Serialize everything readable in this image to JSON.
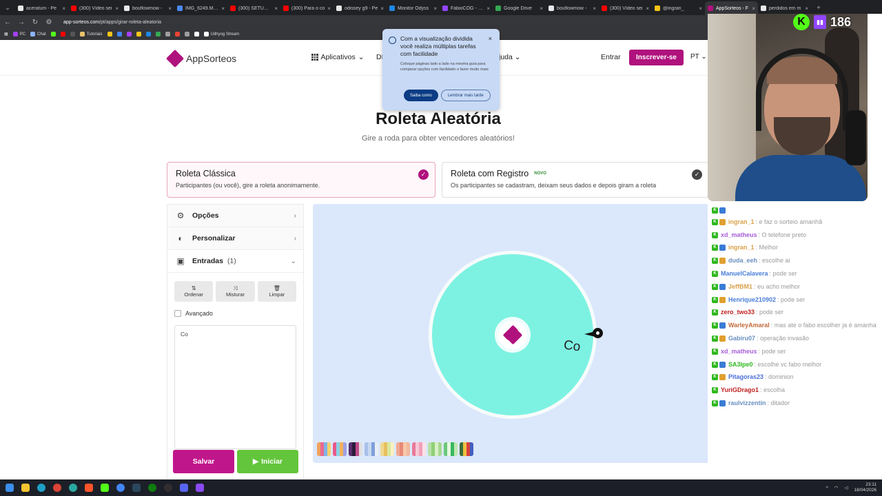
{
  "browser": {
    "tabs": [
      {
        "title": "aceratum - Pe",
        "color": "#e8e8e8",
        "active": false
      },
      {
        "title": "(300) Vídeo sei",
        "color": "#ff0000",
        "active": false
      },
      {
        "title": "bouflowmow -",
        "color": "#e8e8e8",
        "active": false
      },
      {
        "title": "IMG_6249.MOV",
        "color": "#4a8af4",
        "active": false
      },
      {
        "title": "(300) SETUP D",
        "color": "#ff0000",
        "active": false
      },
      {
        "title": "(300) Para o co",
        "color": "#ff0000",
        "active": false
      },
      {
        "title": "odissey g9 - Pe",
        "color": "#e8e8e8",
        "active": false
      },
      {
        "title": "Monitor Odyss",
        "color": "#1e88e5",
        "active": false
      },
      {
        "title": "FabioCOG - Ch",
        "color": "#9146ff",
        "active": false
      },
      {
        "title": "Google Drive",
        "color": "#34a853",
        "active": false
      },
      {
        "title": "bouflowmow -",
        "color": "#e8e8e8",
        "active": false
      },
      {
        "title": "(300) Vídeo sei",
        "color": "#ff0000",
        "active": false
      },
      {
        "title": "@ingran_",
        "color": "#f5c518",
        "active": false
      },
      {
        "title": "AppSorteos - F",
        "color": "#b0127d",
        "active": true
      },
      {
        "title": "perdidos em m",
        "color": "#e8e8e8",
        "active": false
      }
    ],
    "url_host": "app-sorteos.com",
    "url_path": "/pt/apps/girar-roleta-aleatoria",
    "bookmarks": [
      {
        "label": "PC",
        "color": "#a142f4"
      },
      {
        "label": "Chat",
        "color": "#8ab4f8"
      },
      {
        "label": "",
        "color": "#53fc18"
      },
      {
        "label": "",
        "color": "#ff0000"
      },
      {
        "label": "",
        "color": "#555555"
      },
      {
        "label": "Tutoriais",
        "color": "#e8c26b"
      },
      {
        "label": "",
        "color": "#f5c518"
      },
      {
        "label": "",
        "color": "#4285f4"
      },
      {
        "label": "",
        "color": "#a142f4"
      },
      {
        "label": "",
        "color": "#f5c518"
      },
      {
        "label": "",
        "color": "#1e88e5"
      },
      {
        "label": "",
        "color": "#34a853"
      },
      {
        "label": "",
        "color": "#9e9e9e"
      },
      {
        "label": "",
        "color": "#ea4335"
      },
      {
        "label": "",
        "color": "#9e9e9e"
      },
      {
        "label": "",
        "color": "#ffffff"
      },
      {
        "label": "Udhyog Stream",
        "color": "#ffffff"
      }
    ]
  },
  "header": {
    "logo_text": "AppSorteos",
    "apps_menu": "Aplicativos",
    "di_menu": "DI",
    "help_menu": "juda",
    "login": "Entrar",
    "signup": "Inscrever-se",
    "language": "PT"
  },
  "popup": {
    "title": "Com a visualização dividida você realiza múltiplas tarefas com facilidade",
    "body": "Coloque páginas lado a lado na mesma guia para comparar opções com facilidade e fazer muito mais",
    "primary": "Saiba como",
    "secondary": "Lembrar mais tarde",
    "close": "×"
  },
  "hero": {
    "title": "Roleta Aleatória",
    "subtitle": "Gire a roda para obter vencedores aleatórios!"
  },
  "modes": {
    "classic": {
      "title": "Roleta Clássica",
      "desc": "Participantes (ou você), gire a roleta anonimamente."
    },
    "registry": {
      "title": "Roleta com Registro",
      "badge": "NOVO",
      "desc": "Os participantes se cadastram, deixam seus dados e depois giram a roleta"
    }
  },
  "panel": {
    "options": "Opções",
    "customize": "Personalizar",
    "entries": "Entradas",
    "entries_count": "(1)",
    "sort": "Ordenar",
    "shuffle": "Misturar",
    "clear": "Limpar",
    "advanced": "Avançado",
    "entries_text": "Co",
    "save": "Salvar",
    "start": "Iniciar"
  },
  "wheel": {
    "segment_label": "Co",
    "segment_color": "#7df2e2",
    "palettes": [
      [
        "#f0a35e",
        "#e86a8f",
        "#7fb3e6",
        "#f7d16b"
      ],
      [
        "#e85a8a",
        "#8ad1e6",
        "#f0b25e",
        "#a0a0e6"
      ],
      [
        "#5a2f6e",
        "#2b1b3d",
        "#c04a8a",
        "#e0e0e0"
      ],
      [
        "#a8c0e8",
        "#c8d8f0",
        "#7f9fd8",
        "#e8eef8"
      ],
      [
        "#f0d890",
        "#e8c060",
        "#d8e8a0",
        "#f8f0c0"
      ],
      [
        "#f0a890",
        "#e88878",
        "#f8c8a8",
        "#f0b8a0"
      ],
      [
        "#e87a9a",
        "#f8c8d8",
        "#f0a0b8",
        "#fce0e8"
      ],
      [
        "#b8e0a8",
        "#90d078",
        "#d8f0c8",
        "#a8d890"
      ],
      [
        "#6ac87a",
        "#e8f8e0",
        "#3ab860",
        "#c0e8b0"
      ],
      [
        "#3a6e3a",
        "#f0c040",
        "#d84040",
        "#4060c0"
      ]
    ]
  },
  "stream": {
    "viewer_count": "186",
    "chat": [
      {
        "user": "",
        "msg": "",
        "color": "#d98a4a"
      },
      {
        "user": "ingran_1",
        "msg": ": e faz o sorteio amanhã",
        "color": "#d9a24a"
      },
      {
        "user": "xd_matheus",
        "msg": ": O telefone preto",
        "color": "#a65fd9"
      },
      {
        "user": "ingran_1",
        "msg": ": Melhor",
        "color": "#d9a24a"
      },
      {
        "user": "duda_eeh",
        "msg": ": escolhe ai",
        "color": "#6a8fc0"
      },
      {
        "user": "ManuelCalavera",
        "msg": ": pode ser",
        "color": "#4a7fd9"
      },
      {
        "user": "JeffBM1",
        "msg": ": eu acho melhor",
        "color": "#d9a24a"
      },
      {
        "user": "Henrique210902",
        "msg": ": pode ser",
        "color": "#4a7fd9"
      },
      {
        "user": "zero_two33",
        "msg": ": pode ser",
        "color": "#c02020"
      },
      {
        "user": "WarleyAmaral",
        "msg": ": mas ate o fabo escolher ja é amanha",
        "color": "#c06a3a"
      },
      {
        "user": "Gabiru07",
        "msg": ": operação invasão",
        "color": "#6a8fc0"
      },
      {
        "user": "xd_matheus",
        "msg": ": pode ser",
        "color": "#a65fd9"
      },
      {
        "user": "SA3Ipe0",
        "msg": ": escolhe vc fabo melhor",
        "color": "#2fb81d"
      },
      {
        "user": "Pitagoras23",
        "msg": ": dominion",
        "color": "#4a6fd9"
      },
      {
        "user": "YuriGDrago1",
        "msg": ": escolha",
        "color": "#c02020"
      },
      {
        "user": "raulvizzentin",
        "msg": ": ditador",
        "color": "#6a8fc0"
      }
    ]
  },
  "taskbar": {
    "time": "23:11",
    "date": "18/04/2026"
  }
}
